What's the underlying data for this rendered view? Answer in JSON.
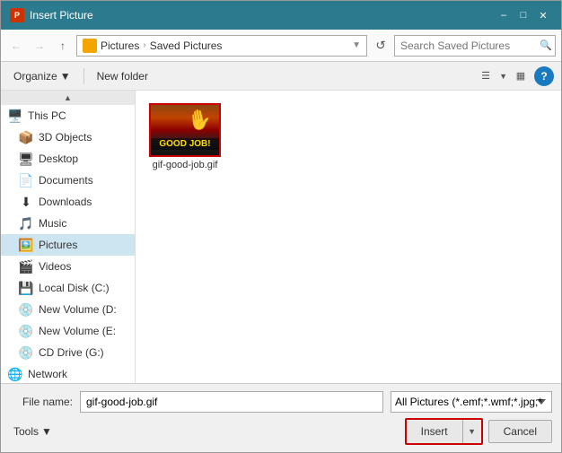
{
  "window": {
    "title": "Insert Picture",
    "icon": "P"
  },
  "nav": {
    "back_tooltip": "Back",
    "forward_tooltip": "Forward",
    "up_tooltip": "Up",
    "breadcrumb_part1": "Pictures",
    "breadcrumb_arrow": "›",
    "breadcrumb_part2": "Saved Pictures",
    "search_placeholder": "Search Saved Pictures",
    "refresh_tooltip": "Refresh"
  },
  "toolbar": {
    "organize_label": "Organize",
    "new_folder_label": "New folder",
    "help_label": "?"
  },
  "sidebar": {
    "scroll_up": "▲",
    "scroll_down": "▼",
    "items": [
      {
        "id": "this-pc",
        "label": "This PC",
        "icon": "🖥️"
      },
      {
        "id": "3d-objects",
        "label": "3D Objects",
        "icon": "📦"
      },
      {
        "id": "desktop",
        "label": "Desktop",
        "icon": "🖥"
      },
      {
        "id": "documents",
        "label": "Documents",
        "icon": "📄"
      },
      {
        "id": "downloads",
        "label": "Downloads",
        "icon": "⬇"
      },
      {
        "id": "music",
        "label": "Music",
        "icon": "🎵"
      },
      {
        "id": "pictures",
        "label": "Pictures",
        "icon": "🖼️",
        "selected": true
      },
      {
        "id": "videos",
        "label": "Videos",
        "icon": "🎬"
      },
      {
        "id": "local-disk-c",
        "label": "Local Disk (C:)",
        "icon": "💾"
      },
      {
        "id": "new-volume-d",
        "label": "New Volume (D:",
        "icon": "💿"
      },
      {
        "id": "new-volume-e",
        "label": "New Volume (E:",
        "icon": "💿"
      },
      {
        "id": "cd-drive-g",
        "label": "CD Drive (G:)",
        "icon": "💿"
      },
      {
        "id": "network",
        "label": "Network",
        "icon": "🌐"
      }
    ]
  },
  "files": [
    {
      "id": "gif-good-job",
      "name": "gif-good-job.gif",
      "overlay_text": "GOOD JOB!"
    }
  ],
  "bottom": {
    "filename_label": "File name:",
    "filename_value": "gif-good-job.gif",
    "filetype_value": "All Pictures (*.emf;*.wmf;*.jpg;*",
    "tools_label": "Tools",
    "insert_label": "Insert",
    "cancel_label": "Cancel"
  }
}
